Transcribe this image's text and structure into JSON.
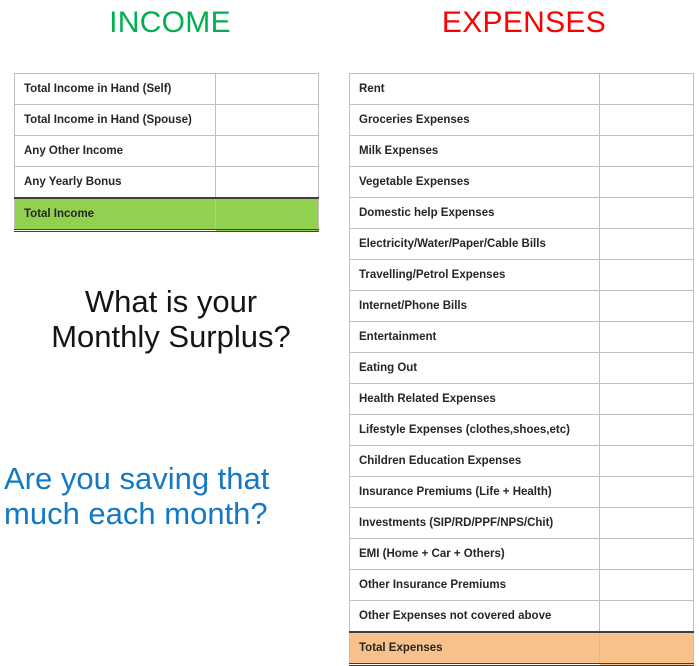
{
  "headings": {
    "income": "INCOME",
    "expenses": "EXPENSES"
  },
  "colors": {
    "income_heading": "#00B050",
    "expenses_heading": "#FF0000",
    "income_total_fill": "#92D050",
    "expenses_total_fill": "#F8C08A",
    "body_text": "#262626",
    "question_black": "#151515",
    "question_blue": "#1479C4",
    "grid_line": "#BFBFBF"
  },
  "income_table": {
    "rows": [
      {
        "label": "Total Income in Hand (Self)",
        "value": ""
      },
      {
        "label": "Total Income in Hand (Spouse)",
        "value": ""
      },
      {
        "label": "Any Other Income",
        "value": ""
      },
      {
        "label": "Any Yearly Bonus",
        "value": ""
      }
    ],
    "total": {
      "label": "Total Income",
      "value": ""
    }
  },
  "expenses_table": {
    "rows": [
      {
        "label": "Rent",
        "value": ""
      },
      {
        "label": "Groceries Expenses",
        "value": ""
      },
      {
        "label": "Milk Expenses",
        "value": ""
      },
      {
        "label": "Vegetable Expenses",
        "value": ""
      },
      {
        "label": "Domestic help Expenses",
        "value": ""
      },
      {
        "label": "Electricity/Water/Paper/Cable Bills",
        "value": ""
      },
      {
        "label": "Travelling/Petrol Expenses",
        "value": ""
      },
      {
        "label": "Internet/Phone Bills",
        "value": ""
      },
      {
        "label": "Entertainment",
        "value": ""
      },
      {
        "label": "Eating Out",
        "value": ""
      },
      {
        "label": "Health Related Expenses",
        "value": ""
      },
      {
        "label": "Lifestyle Expenses (clothes,shoes,etc)",
        "value": ""
      },
      {
        "label": "Children Education Expenses",
        "value": ""
      },
      {
        "label": "Insurance Premiums (Life + Health)",
        "value": ""
      },
      {
        "label": "Investments (SIP/RD/PPF/NPS/Chit)",
        "value": ""
      },
      {
        "label": "EMI (Home + Car + Others)",
        "value": ""
      },
      {
        "label": "Other Insurance Premiums",
        "value": ""
      },
      {
        "label": "Other Expenses not covered above",
        "value": ""
      }
    ],
    "total": {
      "label": "Total Expenses",
      "value": ""
    }
  },
  "questions": {
    "surplus": {
      "line1": "What is your",
      "line2": "Monthly Surplus?"
    },
    "saving": {
      "line1": "Are you saving that",
      "line2": "much each month?"
    }
  }
}
